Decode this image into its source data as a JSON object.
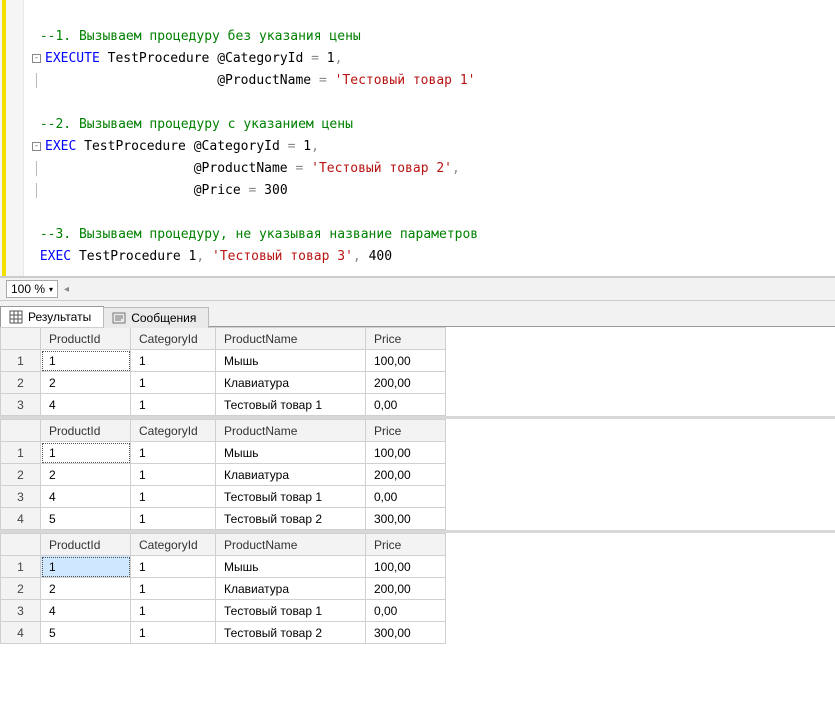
{
  "code": {
    "line1": "--1. Вызываем процедуру без указания цены",
    "exec1_kw": "EXECUTE",
    "proc_name": "TestProcedure",
    "param_cat": "@CategoryId",
    "eq": "=",
    "val1": "1",
    "comma": ",",
    "param_name": "@ProductName",
    "str1": "'Тестовый товар 1'",
    "line2": "--2. Вызываем процедуру с указанием цены",
    "exec2_kw": "EXEC",
    "str2": "'Тестовый товар 2'",
    "param_price": "@Price",
    "val300": "300",
    "line3": "--3. Вызываем процедуру, не указывая название параметров",
    "str3": "'Тестовый товар 3'",
    "val400": "400"
  },
  "zoom": {
    "value": "100 %"
  },
  "tabs": {
    "results": "Результаты",
    "messages": "Сообщения"
  },
  "headers": {
    "pid": "ProductId",
    "cid": "CategoryId",
    "name": "ProductName",
    "price": "Price"
  },
  "grids": [
    {
      "rows": [
        {
          "n": "1",
          "pid": "1",
          "cid": "1",
          "name": "Мышь",
          "price": "100,00"
        },
        {
          "n": "2",
          "pid": "2",
          "cid": "1",
          "name": "Клавиатура",
          "price": "200,00"
        },
        {
          "n": "3",
          "pid": "4",
          "cid": "1",
          "name": "Тестовый товар 1",
          "price": "0,00"
        }
      ]
    },
    {
      "rows": [
        {
          "n": "1",
          "pid": "1",
          "cid": "1",
          "name": "Мышь",
          "price": "100,00"
        },
        {
          "n": "2",
          "pid": "2",
          "cid": "1",
          "name": "Клавиатура",
          "price": "200,00"
        },
        {
          "n": "3",
          "pid": "4",
          "cid": "1",
          "name": "Тестовый товар 1",
          "price": "0,00"
        },
        {
          "n": "4",
          "pid": "5",
          "cid": "1",
          "name": "Тестовый товар 2",
          "price": "300,00"
        }
      ]
    },
    {
      "rows": [
        {
          "n": "1",
          "pid": "1",
          "cid": "1",
          "name": "Мышь",
          "price": "100,00"
        },
        {
          "n": "2",
          "pid": "2",
          "cid": "1",
          "name": "Клавиатура",
          "price": "200,00"
        },
        {
          "n": "3",
          "pid": "4",
          "cid": "1",
          "name": "Тестовый товар 1",
          "price": "0,00"
        },
        {
          "n": "4",
          "pid": "5",
          "cid": "1",
          "name": "Тестовый товар 2",
          "price": "300,00"
        }
      ]
    }
  ]
}
